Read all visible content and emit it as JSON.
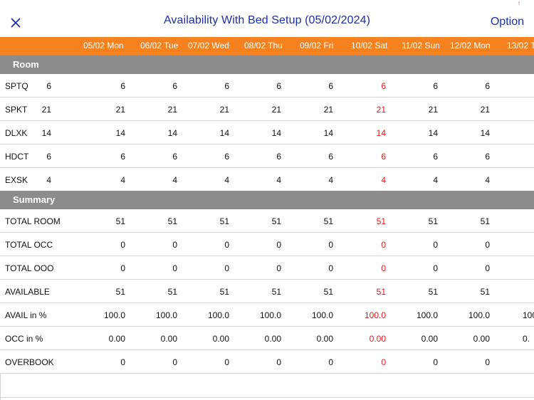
{
  "topbar": {
    "title": "Availability With Bed Setup (05/02/2024)",
    "option_label": "Option",
    "status_glyph": "!"
  },
  "colors": {
    "accent_blue": "#1a2fb0",
    "header_orange": "#f5821f",
    "section_gray": "#8c8c8c",
    "highlight_red": "#e01b1b"
  },
  "dates": [
    "05/02 Mon",
    "06/02 Tue",
    "07/02 Wed",
    "08/02 Thu",
    "09/02 Fri",
    "10/02 Sat",
    "11/02 Sun",
    "12/02 Mon",
    "13/02 T"
  ],
  "highlight_column": "10/02 Sat",
  "sections": {
    "room": "Room",
    "summary": "Summary"
  },
  "room_rows": [
    {
      "label": "SPTQ",
      "total": "6",
      "values": [
        "6",
        "6",
        "6",
        "6",
        "6",
        "6",
        "6",
        "6"
      ]
    },
    {
      "label": "SPKT",
      "total": "21",
      "values": [
        "21",
        "21",
        "21",
        "21",
        "21",
        "21",
        "21",
        "21"
      ]
    },
    {
      "label": "DLXK",
      "total": "14",
      "values": [
        "14",
        "14",
        "14",
        "14",
        "14",
        "14",
        "14",
        "14"
      ]
    },
    {
      "label": "HDCT",
      "total": "6",
      "values": [
        "6",
        "6",
        "6",
        "6",
        "6",
        "6",
        "6",
        "6"
      ]
    },
    {
      "label": "EXSK",
      "total": "4",
      "values": [
        "4",
        "4",
        "4",
        "4",
        "4",
        "4",
        "4",
        "4"
      ]
    }
  ],
  "summary_rows": [
    {
      "label": "TOTAL ROOM",
      "values": [
        "51",
        "51",
        "51",
        "51",
        "51",
        "51",
        "51",
        "51"
      ]
    },
    {
      "label": "TOTAL OCC",
      "values": [
        "0",
        "0",
        "0",
        "0",
        "0",
        "0",
        "0",
        "0"
      ]
    },
    {
      "label": "TOTAL OOO",
      "values": [
        "0",
        "0",
        "0",
        "0",
        "0",
        "0",
        "0",
        "0"
      ]
    },
    {
      "label": "AVAILABLE",
      "values": [
        "51",
        "51",
        "51",
        "51",
        "51",
        "51",
        "51",
        "51"
      ]
    },
    {
      "label": "AVAIL in %",
      "values": [
        "100.0",
        "100.0",
        "100.0",
        "100.0",
        "100.0",
        "100.0",
        "100.0",
        "100.0"
      ],
      "overflow": "100"
    },
    {
      "label": "OCC in %",
      "values": [
        "0.00",
        "0.00",
        "0.00",
        "0.00",
        "0.00",
        "0.00",
        "0.00",
        "0.00"
      ],
      "overflow": "0."
    },
    {
      "label": "OVERBOOK",
      "values": [
        "0",
        "0",
        "0",
        "0",
        "0",
        "0",
        "0",
        "0"
      ]
    }
  ]
}
